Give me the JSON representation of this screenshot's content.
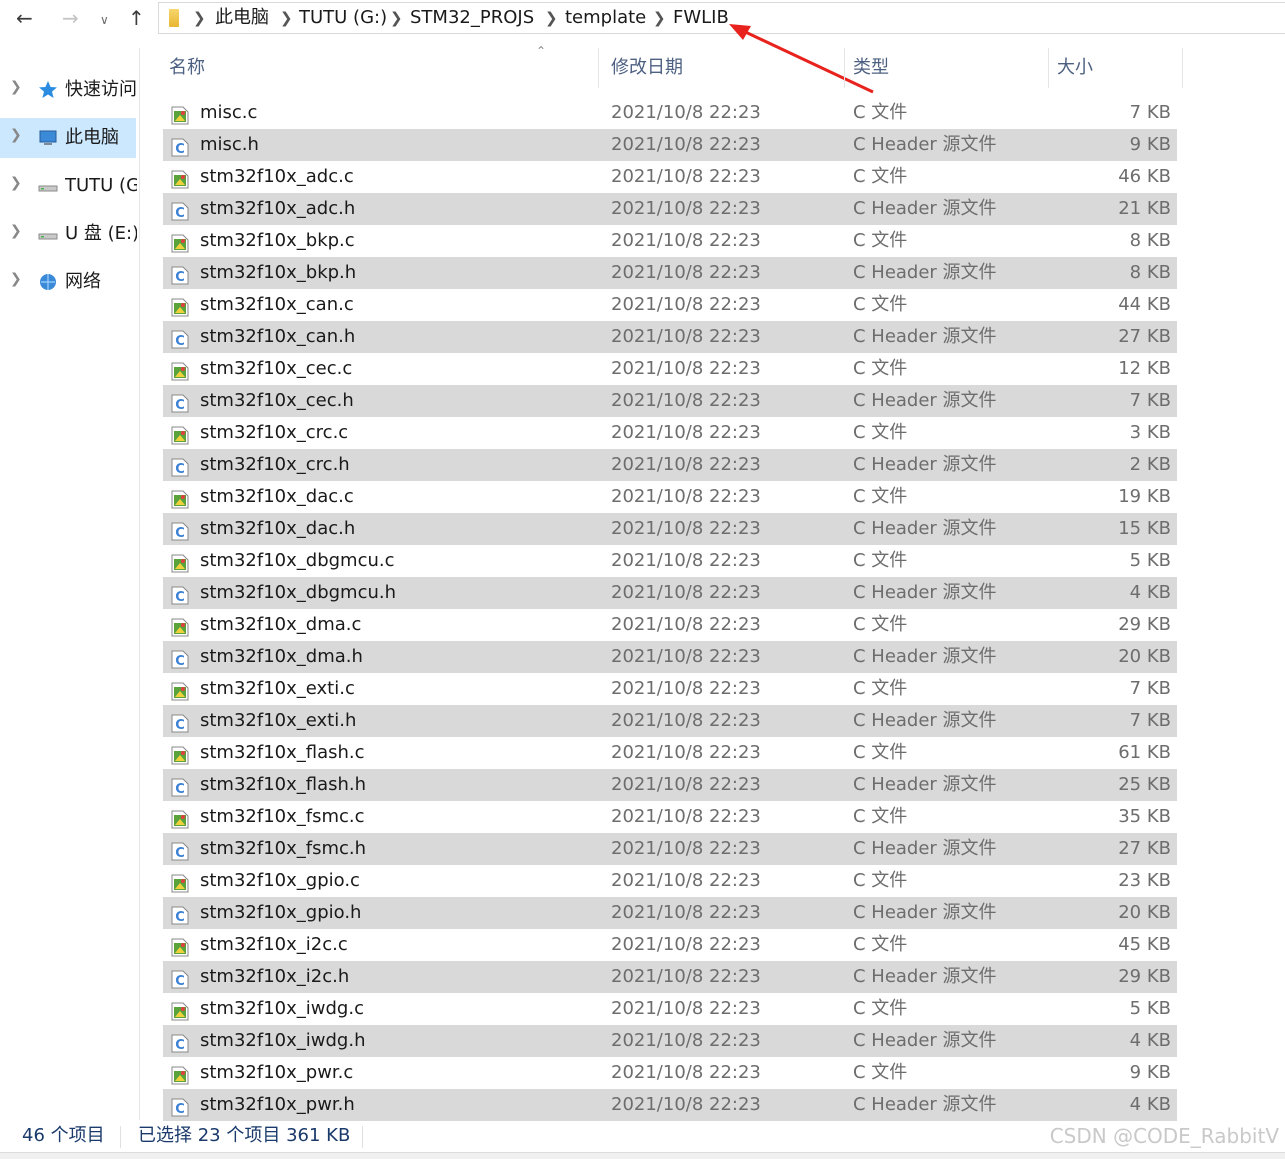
{
  "breadcrumb": [
    "此电脑",
    "TUTU (G:)",
    "STM32_PROJS",
    "template",
    "FWLIB"
  ],
  "sidebar": {
    "items": [
      {
        "label": "快速访问",
        "icon": "star-icon",
        "selected": false
      },
      {
        "label": "此电脑",
        "icon": "computer-icon",
        "selected": true
      },
      {
        "label": "TUTU (G:)",
        "icon": "drive-icon",
        "selected": false
      },
      {
        "label": "U 盘 (E:)",
        "icon": "usb-drive-icon",
        "selected": false
      },
      {
        "label": "网络",
        "icon": "network-icon",
        "selected": false
      }
    ]
  },
  "columns": {
    "name": "名称",
    "date": "修改日期",
    "type": "类型",
    "size": "大小"
  },
  "files": [
    {
      "name": "misc.c",
      "date": "2021/10/8 22:23",
      "type": "C 文件",
      "size": "7 KB",
      "kind": "c",
      "selected": false
    },
    {
      "name": "misc.h",
      "date": "2021/10/8 22:23",
      "type": "C Header 源文件",
      "size": "9 KB",
      "kind": "h",
      "selected": true
    },
    {
      "name": "stm32f10x_adc.c",
      "date": "2021/10/8 22:23",
      "type": "C 文件",
      "size": "46 KB",
      "kind": "c",
      "selected": false
    },
    {
      "name": "stm32f10x_adc.h",
      "date": "2021/10/8 22:23",
      "type": "C Header 源文件",
      "size": "21 KB",
      "kind": "h",
      "selected": true
    },
    {
      "name": "stm32f10x_bkp.c",
      "date": "2021/10/8 22:23",
      "type": "C 文件",
      "size": "8 KB",
      "kind": "c",
      "selected": false
    },
    {
      "name": "stm32f10x_bkp.h",
      "date": "2021/10/8 22:23",
      "type": "C Header 源文件",
      "size": "8 KB",
      "kind": "h",
      "selected": true
    },
    {
      "name": "stm32f10x_can.c",
      "date": "2021/10/8 22:23",
      "type": "C 文件",
      "size": "44 KB",
      "kind": "c",
      "selected": false
    },
    {
      "name": "stm32f10x_can.h",
      "date": "2021/10/8 22:23",
      "type": "C Header 源文件",
      "size": "27 KB",
      "kind": "h",
      "selected": true
    },
    {
      "name": "stm32f10x_cec.c",
      "date": "2021/10/8 22:23",
      "type": "C 文件",
      "size": "12 KB",
      "kind": "c",
      "selected": false
    },
    {
      "name": "stm32f10x_cec.h",
      "date": "2021/10/8 22:23",
      "type": "C Header 源文件",
      "size": "7 KB",
      "kind": "h",
      "selected": true
    },
    {
      "name": "stm32f10x_crc.c",
      "date": "2021/10/8 22:23",
      "type": "C 文件",
      "size": "3 KB",
      "kind": "c",
      "selected": false
    },
    {
      "name": "stm32f10x_crc.h",
      "date": "2021/10/8 22:23",
      "type": "C Header 源文件",
      "size": "2 KB",
      "kind": "h",
      "selected": true
    },
    {
      "name": "stm32f10x_dac.c",
      "date": "2021/10/8 22:23",
      "type": "C 文件",
      "size": "19 KB",
      "kind": "c",
      "selected": false
    },
    {
      "name": "stm32f10x_dac.h",
      "date": "2021/10/8 22:23",
      "type": "C Header 源文件",
      "size": "15 KB",
      "kind": "h",
      "selected": true
    },
    {
      "name": "stm32f10x_dbgmcu.c",
      "date": "2021/10/8 22:23",
      "type": "C 文件",
      "size": "5 KB",
      "kind": "c",
      "selected": false
    },
    {
      "name": "stm32f10x_dbgmcu.h",
      "date": "2021/10/8 22:23",
      "type": "C Header 源文件",
      "size": "4 KB",
      "kind": "h",
      "selected": true
    },
    {
      "name": "stm32f10x_dma.c",
      "date": "2021/10/8 22:23",
      "type": "C 文件",
      "size": "29 KB",
      "kind": "c",
      "selected": false
    },
    {
      "name": "stm32f10x_dma.h",
      "date": "2021/10/8 22:23",
      "type": "C Header 源文件",
      "size": "20 KB",
      "kind": "h",
      "selected": true
    },
    {
      "name": "stm32f10x_exti.c",
      "date": "2021/10/8 22:23",
      "type": "C 文件",
      "size": "7 KB",
      "kind": "c",
      "selected": false
    },
    {
      "name": "stm32f10x_exti.h",
      "date": "2021/10/8 22:23",
      "type": "C Header 源文件",
      "size": "7 KB",
      "kind": "h",
      "selected": true
    },
    {
      "name": "stm32f10x_flash.c",
      "date": "2021/10/8 22:23",
      "type": "C 文件",
      "size": "61 KB",
      "kind": "c",
      "selected": false
    },
    {
      "name": "stm32f10x_flash.h",
      "date": "2021/10/8 22:23",
      "type": "C Header 源文件",
      "size": "25 KB",
      "kind": "h",
      "selected": true
    },
    {
      "name": "stm32f10x_fsmc.c",
      "date": "2021/10/8 22:23",
      "type": "C 文件",
      "size": "35 KB",
      "kind": "c",
      "selected": false
    },
    {
      "name": "stm32f10x_fsmc.h",
      "date": "2021/10/8 22:23",
      "type": "C Header 源文件",
      "size": "27 KB",
      "kind": "h",
      "selected": true
    },
    {
      "name": "stm32f10x_gpio.c",
      "date": "2021/10/8 22:23",
      "type": "C 文件",
      "size": "23 KB",
      "kind": "c",
      "selected": false
    },
    {
      "name": "stm32f10x_gpio.h",
      "date": "2021/10/8 22:23",
      "type": "C Header 源文件",
      "size": "20 KB",
      "kind": "h",
      "selected": true
    },
    {
      "name": "stm32f10x_i2c.c",
      "date": "2021/10/8 22:23",
      "type": "C 文件",
      "size": "45 KB",
      "kind": "c",
      "selected": false
    },
    {
      "name": "stm32f10x_i2c.h",
      "date": "2021/10/8 22:23",
      "type": "C Header 源文件",
      "size": "29 KB",
      "kind": "h",
      "selected": true
    },
    {
      "name": "stm32f10x_iwdg.c",
      "date": "2021/10/8 22:23",
      "type": "C 文件",
      "size": "5 KB",
      "kind": "c",
      "selected": false
    },
    {
      "name": "stm32f10x_iwdg.h",
      "date": "2021/10/8 22:23",
      "type": "C Header 源文件",
      "size": "4 KB",
      "kind": "h",
      "selected": true
    },
    {
      "name": "stm32f10x_pwr.c",
      "date": "2021/10/8 22:23",
      "type": "C 文件",
      "size": "9 KB",
      "kind": "c",
      "selected": false
    },
    {
      "name": "stm32f10x_pwr.h",
      "date": "2021/10/8 22:23",
      "type": "C Header 源文件",
      "size": "4 KB",
      "kind": "h",
      "selected": true
    }
  ],
  "status": {
    "item_count": "46 个项目",
    "selection": "已选择 23 个项目 361 KB"
  },
  "watermark": "CSDN @CODE_RabbitV",
  "colors": {
    "selection": "#d9d9d9",
    "sidebar_selected": "#cce8ff",
    "annotation_arrow": "#e8231e",
    "header_text": "#4d6082"
  }
}
